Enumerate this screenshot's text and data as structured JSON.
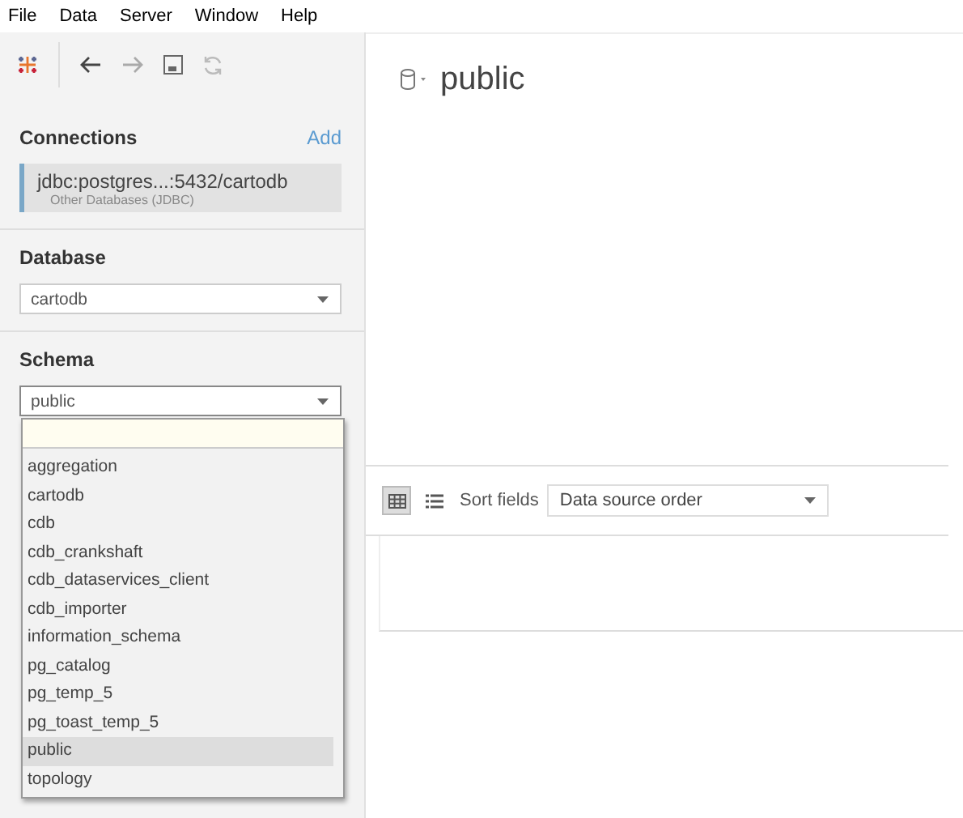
{
  "menu_bar": [
    "File",
    "Data",
    "Server",
    "Window",
    "Help"
  ],
  "sidebar": {
    "connections": {
      "heading": "Connections",
      "add_link": "Add",
      "items": [
        {
          "name": "jdbc:postgres...:5432/cartodb",
          "type": "Other Databases (JDBC)",
          "selected": true
        }
      ]
    },
    "database": {
      "heading": "Database",
      "value": "cartodb"
    },
    "schema": {
      "heading": "Schema",
      "value": "public",
      "expanded": true,
      "options": [
        {
          "label": "aggregation",
          "selected": false
        },
        {
          "label": "cartodb",
          "selected": false
        },
        {
          "label": "cdb",
          "selected": false
        },
        {
          "label": "cdb_crankshaft",
          "selected": false
        },
        {
          "label": "cdb_dataservices_client",
          "selected": false
        },
        {
          "label": "cdb_importer",
          "selected": false
        },
        {
          "label": "information_schema",
          "selected": false
        },
        {
          "label": "pg_catalog",
          "selected": false
        },
        {
          "label": "pg_temp_5",
          "selected": false
        },
        {
          "label": "pg_toast_temp_5",
          "selected": false
        },
        {
          "label": "public",
          "selected": true
        },
        {
          "label": "topology",
          "selected": false
        }
      ]
    }
  },
  "main": {
    "title": "public",
    "views": [
      {
        "kind": "grid",
        "selected": true
      },
      {
        "kind": "list",
        "selected": false
      }
    ],
    "sort_label": "Sort fields",
    "sort_value": "Data source order"
  }
}
